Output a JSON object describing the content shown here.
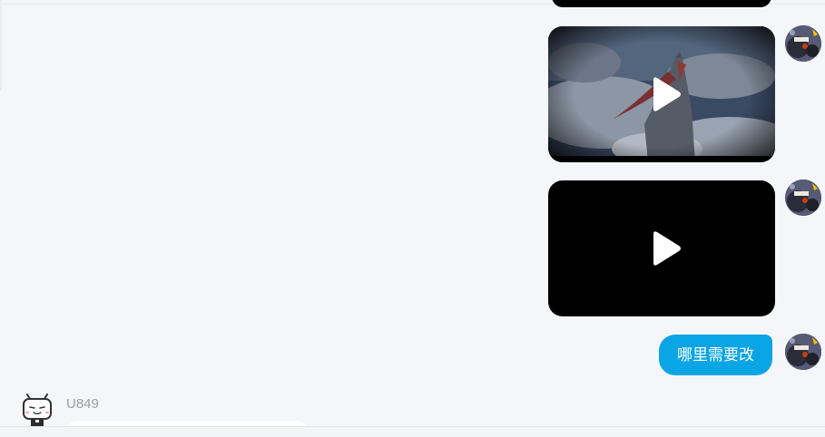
{
  "messages": {
    "outgoing_text": "哪里需要改",
    "incoming_username": "U849"
  },
  "icons": {
    "play": "play-icon",
    "my_avatar": "user-avatar",
    "other_avatar": "tv-mascot-avatar"
  },
  "colors": {
    "background": "#f5f6f9",
    "outgoing_bubble": "#0aa5e5",
    "username": "#999da5"
  }
}
